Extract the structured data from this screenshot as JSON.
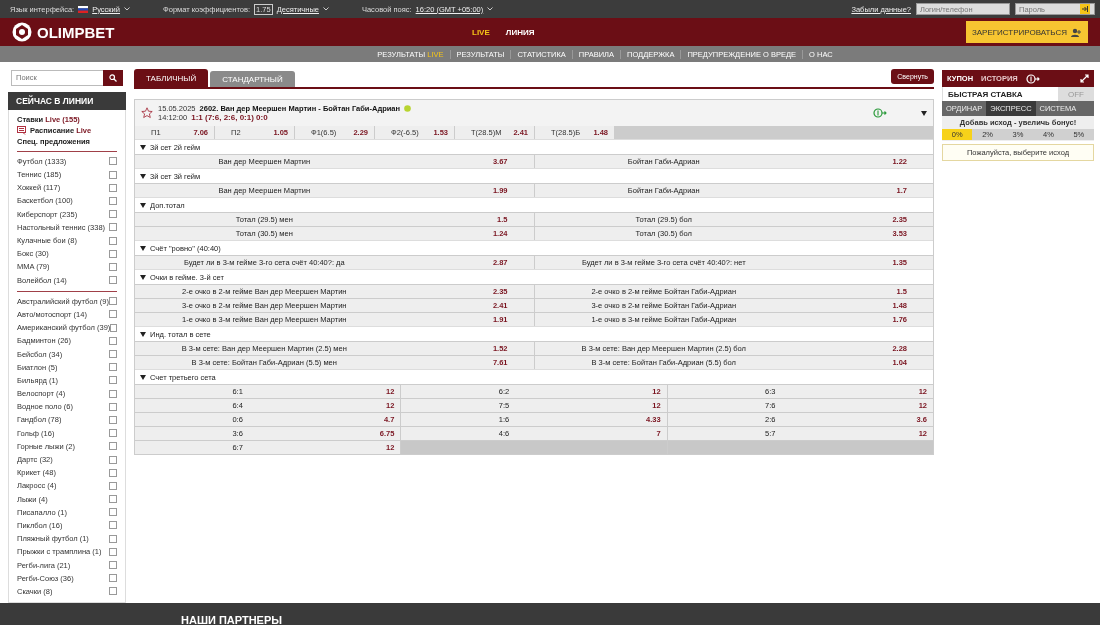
{
  "top_bar": {
    "language_label": "Язык интерфейса:",
    "language": "Русский",
    "odds_format_label": "Формат коэффициентов:",
    "odds_sample": "1.75",
    "odds_format": "Десятичные",
    "timezone_label": "Часовой пояс:",
    "timezone": "16:20 (GMT +05:00)",
    "forgot_link": "Забыли данные?",
    "login_placeholder": "Логин/телефон",
    "password_placeholder": "Пароль"
  },
  "header": {
    "logo": "OLIMPBET",
    "nav": [
      {
        "label": "LIVE",
        "selected": true
      },
      {
        "label": "ЛИНИЯ",
        "selected": false
      }
    ],
    "register_button": "ЗАРЕГИСТРИРОВАТЬСЯ"
  },
  "sub_nav": [
    {
      "label": "РЕЗУЛЬТАТЫ",
      "accent": "LIVE"
    },
    {
      "label": "РЕЗУЛЬТАТЫ"
    },
    {
      "label": "СТАТИСТИКА"
    },
    {
      "label": "ПРАВИЛА"
    },
    {
      "label": "ПОДДЕРЖКА"
    },
    {
      "label": "ПРЕДУПРЕЖДЕНИЕ О ВРЕДЕ"
    },
    {
      "label": "О НАС"
    }
  ],
  "sidebar": {
    "search_placeholder": "Поиск",
    "title": "СЕЙЧАС В ЛИНИИ",
    "links": [
      {
        "label": "Ставки",
        "accent": "Live (155)",
        "kind": "plain"
      },
      {
        "label": "Расписание",
        "accent": "Live",
        "kind": "schedule"
      },
      {
        "label": "Спец. предложения",
        "kind": "plain"
      }
    ],
    "groups": [
      [
        {
          "label": "Футбол (1333)",
          "checked": false
        },
        {
          "label": "Теннис (185)",
          "checked": false
        },
        {
          "label": "Хоккей (117)",
          "checked": false
        },
        {
          "label": "Баскетбол (100)",
          "checked": false
        },
        {
          "label": "Киберспорт (235)",
          "checked": false
        },
        {
          "label": "Настольный теннис (338)",
          "checked": false
        },
        {
          "label": "Кулачные бои (8)",
          "checked": false
        },
        {
          "label": "Бокс (30)",
          "checked": false
        },
        {
          "label": "MMA (79)",
          "checked": false
        },
        {
          "label": "Волейбол (14)",
          "checked": false
        }
      ],
      [
        {
          "label": "Австралийский футбол (9)",
          "checked": false
        },
        {
          "label": "Авто/мотоспорт (14)",
          "checked": false
        },
        {
          "label": "Американский футбол (39)",
          "checked": false
        },
        {
          "label": "Бадминтон (26)",
          "checked": false
        },
        {
          "label": "Бейсбол (34)",
          "checked": false
        },
        {
          "label": "Биатлон (5)",
          "checked": false
        },
        {
          "label": "Бильярд (1)",
          "checked": false
        },
        {
          "label": "Велоспорт (4)",
          "checked": false
        },
        {
          "label": "Водное поло (6)",
          "checked": false
        },
        {
          "label": "Гандбол (78)",
          "checked": false
        },
        {
          "label": "Гольф (16)",
          "checked": false
        },
        {
          "label": "Горные лыжи (2)",
          "checked": false
        },
        {
          "label": "Дартс (32)",
          "checked": false
        },
        {
          "label": "Крикет (48)",
          "checked": false
        },
        {
          "label": "Лакросс (4)",
          "checked": false
        },
        {
          "label": "Лыжи (4)",
          "checked": false
        },
        {
          "label": "Писапалло (1)",
          "checked": false
        },
        {
          "label": "Пиклбол (16)",
          "checked": false
        },
        {
          "label": "Пляжный футбол (1)",
          "checked": false
        },
        {
          "label": "Прыжки с трамплина (1)",
          "checked": false
        },
        {
          "label": "Регби-лига (21)",
          "checked": false
        },
        {
          "label": "Регби-Союз (36)",
          "checked": false
        },
        {
          "label": "Скачки (8)",
          "checked": false
        }
      ]
    ]
  },
  "main": {
    "view_tabs": [
      {
        "label": "ТАБЛИЧНЫЙ",
        "selected": true
      },
      {
        "label": "СТАНДАРТНЫЙ",
        "selected": false
      }
    ],
    "collapse_button": "Свернуть",
    "event": {
      "date": "15.05.2025",
      "time": "14:12:00",
      "title": "2602. Ван дер Меершен Мартин - Бойтан Габи-Адриан",
      "score": "1:1 (7:6, 2:6, 0:1) 0:0",
      "favorite": false,
      "odds": [
        {
          "label": "П1",
          "value": "7.06"
        },
        {
          "label": "П2",
          "value": "1.05"
        },
        {
          "label": "Ф1(6.5)",
          "value": "2.29"
        },
        {
          "label": "Ф2(-6.5)",
          "value": "1.53"
        },
        {
          "label": "Т(28.5)М",
          "value": "2.41"
        },
        {
          "label": "Т(28.5)Б",
          "value": "1.48"
        }
      ],
      "markets": [
        {
          "title": "3й сет 2й гейм",
          "expanded": true,
          "kind": "pair",
          "rows": [
            [
              {
                "label": "Ван дер Меершен Мартин",
                "odd": "3.67"
              },
              {
                "label": "Бойтан Габи-Адриан",
                "odd": "1.22"
              }
            ]
          ]
        },
        {
          "title": "3й сет 3й гейм",
          "expanded": true,
          "kind": "pair",
          "rows": [
            [
              {
                "label": "Ван дер Меершен Мартин",
                "odd": "1.99"
              },
              {
                "label": "Бойтан Габи-Адриан",
                "odd": "1.7"
              }
            ]
          ]
        },
        {
          "title": "Доп.тотал",
          "expanded": true,
          "kind": "pair",
          "rows": [
            [
              {
                "label": "Тотал (29.5) мен",
                "odd": "1.5"
              },
              {
                "label": "Тотал (29.5) бол",
                "odd": "2.35"
              }
            ],
            [
              {
                "label": "Тотал (30.5) мен",
                "odd": "1.24"
              },
              {
                "label": "Тотал (30.5) бол",
                "odd": "3.53"
              }
            ]
          ]
        },
        {
          "title": "Счёт \"ровно\" (40:40)",
          "expanded": true,
          "kind": "pair",
          "rows": [
            [
              {
                "label": "Будет ли в 3-м гейме 3-го сета счёт 40:40?: да",
                "odd": "2.87"
              },
              {
                "label": "Будет ли в 3-м гейме 3-го сета счёт 40:40?: нет",
                "odd": "1.35"
              }
            ]
          ]
        },
        {
          "title": "Очки в гейме. 3-й сет",
          "expanded": true,
          "kind": "pair",
          "rows": [
            [
              {
                "label": "2-е очко в 2-м гейме Ван дер Меершен Мартин",
                "odd": "2.35"
              },
              {
                "label": "2-е очко в 2-м гейме Бойтан Габи-Адриан",
                "odd": "1.5"
              }
            ],
            [
              {
                "label": "3-е очко в 2-м гейме Ван дер Меершен Мартин",
                "odd": "2.41"
              },
              {
                "label": "3-е очко в 2-м гейме Бойтан Габи-Адриан",
                "odd": "1.48"
              }
            ],
            [
              {
                "label": "1-е очко в 3-м гейме Ван дер Меершен Мартин",
                "odd": "1.91"
              },
              {
                "label": "1-е очко в 3-м гейме Бойтан Габи-Адриан",
                "odd": "1.76"
              }
            ]
          ]
        },
        {
          "title": "Инд. тотал в сете",
          "expanded": true,
          "kind": "pair",
          "rows": [
            [
              {
                "label": "В 3-м сете: Ван дер Меершен Мартин (2.5) мен",
                "odd": "1.52"
              },
              {
                "label": "В 3-м сете: Ван дер Меершен Мартин (2.5) бол",
                "odd": "2.28"
              }
            ],
            [
              {
                "label": "В 3-м сете: Бойтан Габи-Адриан (5.5) мен",
                "odd": "7.61"
              },
              {
                "label": "В 3-м сете: Бойтан Габи-Адриан (5.5) бол",
                "odd": "1.04"
              }
            ]
          ]
        },
        {
          "title": "Счет третьего сета",
          "expanded": true,
          "kind": "triple",
          "rows": [
            [
              {
                "label": "6:1",
                "odd": "12"
              },
              {
                "label": "6:2",
                "odd": "12"
              },
              {
                "label": "6:3",
                "odd": "12"
              }
            ],
            [
              {
                "label": "6:4",
                "odd": "12"
              },
              {
                "label": "7:5",
                "odd": "12"
              },
              {
                "label": "7:6",
                "odd": "12"
              }
            ],
            [
              {
                "label": "0:6",
                "odd": "4.7"
              },
              {
                "label": "1:6",
                "odd": "4.33"
              },
              {
                "label": "2:6",
                "odd": "3.6"
              }
            ],
            [
              {
                "label": "3:6",
                "odd": "6.75"
              },
              {
                "label": "4:6",
                "odd": "7"
              },
              {
                "label": "5:7",
                "odd": "12"
              }
            ],
            [
              {
                "label": "6:7",
                "odd": "12"
              }
            ]
          ]
        }
      ]
    }
  },
  "coupon": {
    "tabs": [
      {
        "label": "КУПОН",
        "selected": true
      },
      {
        "label": "ИСТОРИЯ",
        "selected": false
      }
    ],
    "quick_bet": {
      "label": "БЫСТРАЯ СТАВКА",
      "toggle": "OFF",
      "on": false
    },
    "bet_types": [
      {
        "label": "ОРДИНАР",
        "selected": false
      },
      {
        "label": "ЭКСПРЕСС",
        "selected": true
      },
      {
        "label": "СИСТЕМА",
        "selected": false
      }
    ],
    "bonus_hint": "Добавь исход - увеличь бонус!",
    "bonus_levels": [
      {
        "label": "0%",
        "selected": true
      },
      {
        "label": "2%",
        "selected": false
      },
      {
        "label": "3%",
        "selected": false
      },
      {
        "label": "4%",
        "selected": false
      },
      {
        "label": "5%",
        "selected": false
      }
    ],
    "message": "Пожалуйста, выберите исход"
  },
  "footer": {
    "title": "НАШИ ПАРТНЕРЫ"
  }
}
